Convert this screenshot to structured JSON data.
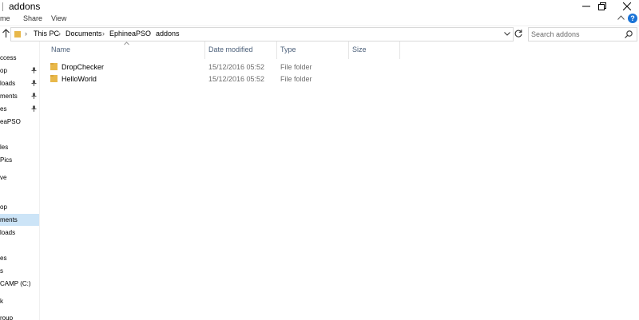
{
  "window": {
    "title": "addons"
  },
  "ribbon": {
    "tabs": [
      "me",
      "Share",
      "View"
    ]
  },
  "address": {
    "crumbs": [
      "This PC",
      "Documents",
      "EphineaPSO",
      "addons"
    ],
    "search_placeholder": "Search addons"
  },
  "nav": {
    "items": [
      {
        "label": "ccess",
        "pinned": false
      },
      {
        "label": "op",
        "pinned": true
      },
      {
        "label": "loads",
        "pinned": true
      },
      {
        "label": "ments",
        "pinned": true
      },
      {
        "label": "es",
        "pinned": true
      },
      {
        "label": "eaPSO",
        "pinned": false
      },
      {
        "label": "les",
        "pinned": false
      },
      {
        "label": "Pics",
        "pinned": false
      },
      {
        "label": "ve",
        "pinned": false
      },
      {
        "label": "op",
        "pinned": false
      },
      {
        "label": "ments",
        "pinned": false
      },
      {
        "label": "loads",
        "pinned": false
      },
      {
        "label": "es",
        "pinned": false
      },
      {
        "label": "s",
        "pinned": false
      },
      {
        "label": "CAMP (C:)",
        "pinned": false
      },
      {
        "label": "k",
        "pinned": false
      },
      {
        "label": "roup",
        "pinned": false
      }
    ]
  },
  "columns": {
    "name": "Name",
    "date": "Date modified",
    "type": "Type",
    "size": "Size"
  },
  "files": [
    {
      "name": "DropChecker",
      "date": "15/12/2016 05:52",
      "type": "File folder",
      "size": ""
    },
    {
      "name": "HelloWorld",
      "date": "15/12/2016 05:52",
      "type": "File folder",
      "size": ""
    }
  ],
  "colors": {
    "accent": "#1a73d6",
    "selected_bg": "#cce4f7",
    "header_text": "#4c607a",
    "folder": "#e8b84a"
  }
}
